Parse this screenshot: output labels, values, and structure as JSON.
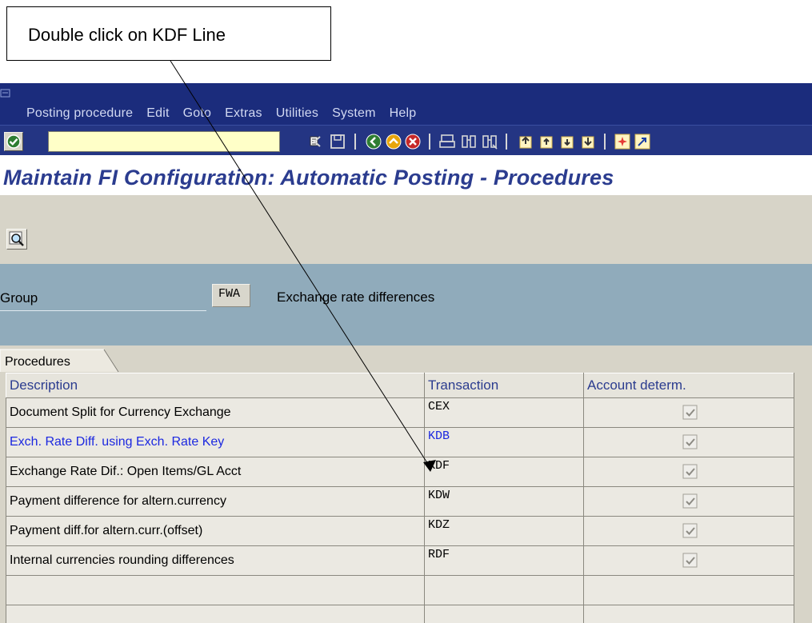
{
  "annotation": {
    "text": "Double click on KDF Line"
  },
  "menu": {
    "items": [
      "Posting procedure",
      "Edit",
      "Goto",
      "Extras",
      "Utilities",
      "System",
      "Help"
    ]
  },
  "toolbar": {
    "command_value": "",
    "icons": [
      "enter-icon",
      "back-icon",
      "save-icon",
      "back-green-icon",
      "exit-icon",
      "cancel-icon",
      "print-icon",
      "find-icon",
      "find-next-icon",
      "first-page-icon",
      "previous-page-icon",
      "next-page-icon",
      "last-page-icon",
      "create-session-icon",
      "shortcut-icon"
    ]
  },
  "title": "Maintain FI Configuration: Automatic Posting - Procedures",
  "header": {
    "group_label": "Group",
    "group_value": "FWA",
    "group_desc": "Exchange rate differences"
  },
  "tab": {
    "label": "Procedures"
  },
  "table": {
    "columns": [
      "Description",
      "Transaction",
      "Account determ."
    ],
    "rows": [
      {
        "description": "Document Split for Currency Exchange",
        "transaction": "CEX",
        "account_determ": true,
        "selected": false
      },
      {
        "description": "Exch. Rate Diff. using Exch. Rate Key",
        "transaction": "KDB",
        "account_determ": true,
        "selected": true
      },
      {
        "description": "Exchange Rate Dif.: Open Items/GL Acct",
        "transaction": "KDF",
        "account_determ": true,
        "selected": false
      },
      {
        "description": "Payment difference for altern.currency",
        "transaction": "KDW",
        "account_determ": true,
        "selected": false
      },
      {
        "description": "Payment diff.for altern.curr.(offset)",
        "transaction": "KDZ",
        "account_determ": true,
        "selected": false
      },
      {
        "description": "Internal currencies rounding differences",
        "transaction": "RDF",
        "account_determ": true,
        "selected": false
      }
    ]
  },
  "colors": {
    "menubar": "#1b2c7c",
    "title": "#2b3c8f",
    "header_bg": "#90abbb",
    "body_bg": "#d7d4c8",
    "selected_text": "#1c28e0"
  }
}
